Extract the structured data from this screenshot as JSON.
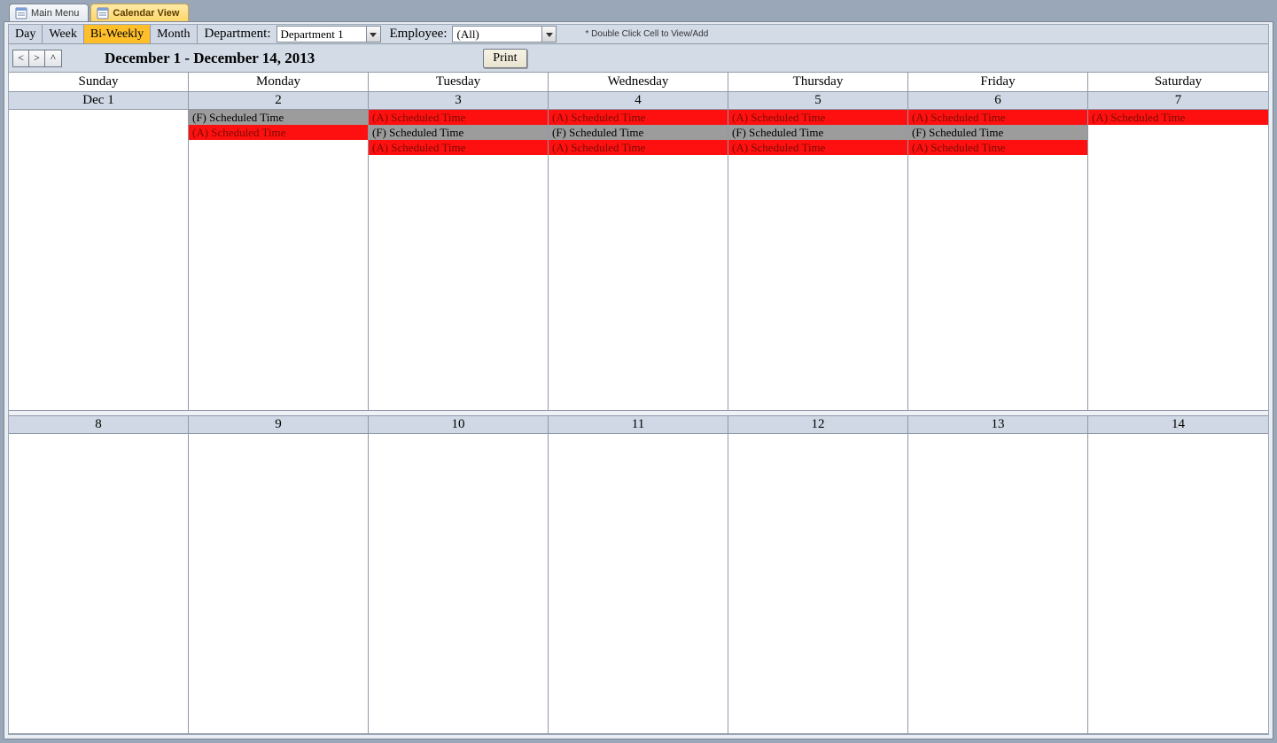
{
  "tabs": [
    {
      "label": "Main Menu",
      "active": false
    },
    {
      "label": "Calendar View",
      "active": true
    }
  ],
  "toolbar": {
    "views": [
      {
        "label": "Day",
        "active": false
      },
      {
        "label": "Week",
        "active": false
      },
      {
        "label": "Bi-Weekly",
        "active": true
      },
      {
        "label": "Month",
        "active": false
      }
    ],
    "department_label": "Department:",
    "department_value": "Department 1",
    "employee_label": "Employee:",
    "employee_value": "(All)",
    "hint": "* Double Click Cell to View/Add"
  },
  "nav": {
    "prev": "<",
    "next": ">",
    "up": "^",
    "range": "December 1 - December 14, 2013",
    "print": "Print"
  },
  "dow": [
    "Sunday",
    "Monday",
    "Tuesday",
    "Wednesday",
    "Thursday",
    "Friday",
    "Saturday"
  ],
  "weeks": [
    {
      "days": [
        {
          "num": "Dec 1",
          "events": []
        },
        {
          "num": "2",
          "events": [
            {
              "text": "(F) Scheduled Time",
              "type": "f"
            },
            {
              "text": "(A) Scheduled Time",
              "type": "a"
            }
          ]
        },
        {
          "num": "3",
          "events": [
            {
              "text": "(A) Scheduled Time",
              "type": "a"
            },
            {
              "text": "(F) Scheduled Time",
              "type": "f"
            },
            {
              "text": "(A) Scheduled Time",
              "type": "a"
            }
          ]
        },
        {
          "num": "4",
          "events": [
            {
              "text": "(A) Scheduled Time",
              "type": "a"
            },
            {
              "text": "(F) Scheduled Time",
              "type": "f"
            },
            {
              "text": "(A) Scheduled Time",
              "type": "a"
            }
          ]
        },
        {
          "num": "5",
          "events": [
            {
              "text": "(A) Scheduled Time",
              "type": "a"
            },
            {
              "text": "(F) Scheduled Time",
              "type": "f"
            },
            {
              "text": "(A) Scheduled Time",
              "type": "a"
            }
          ]
        },
        {
          "num": "6",
          "events": [
            {
              "text": "(A) Scheduled Time",
              "type": "a"
            },
            {
              "text": "(F) Scheduled Time",
              "type": "f"
            },
            {
              "text": "(A) Scheduled Time",
              "type": "a"
            }
          ]
        },
        {
          "num": "7",
          "events": [
            {
              "text": "(A) Scheduled Time",
              "type": "a"
            }
          ]
        }
      ]
    },
    {
      "days": [
        {
          "num": "8",
          "events": []
        },
        {
          "num": "9",
          "events": []
        },
        {
          "num": "10",
          "events": []
        },
        {
          "num": "11",
          "events": []
        },
        {
          "num": "12",
          "events": []
        },
        {
          "num": "13",
          "events": []
        },
        {
          "num": "14",
          "events": []
        }
      ]
    }
  ],
  "colors": {
    "a": "#ff1010",
    "f": "#9c9c9c",
    "header": "#cfd8e4",
    "active_tab": "#ffbf2b"
  }
}
